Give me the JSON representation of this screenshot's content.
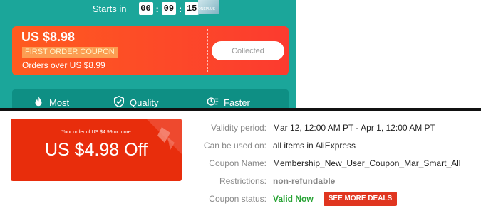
{
  "timer": {
    "label": "Starts in",
    "hours": "00",
    "minutes": "09",
    "seconds": "15",
    "sep": ":"
  },
  "product_tag": "ONEPLUS",
  "coupon": {
    "amount": "US $8.98",
    "badge": "FIRST ORDER COUPON",
    "min_order": "Orders over US $8.99",
    "button": "Collected"
  },
  "features": [
    {
      "label": "Most",
      "icon": "flame-icon"
    },
    {
      "label": "Quality",
      "icon": "shield-check-icon"
    },
    {
      "label": "Faster",
      "icon": "delivery-icon"
    }
  ],
  "offer": {
    "order_text": "Your order of US $4.99 or more",
    "amount": "US $4.98 Off"
  },
  "details": {
    "validity_label": "Validity period:",
    "validity_value": "Mar 12, 12:00 AM PT - Apr 1, 12:00 AM PT",
    "usage_label": "Can be used on:",
    "usage_value": "all items in AliExpress",
    "name_label": "Coupon Name:",
    "name_value": "Membership_New_User_Coupon_Mar_Smart_All",
    "restrictions_label": "Restrictions:",
    "restrictions_value": "non-refundable",
    "status_label": "Coupon status:",
    "status_value": "Valid Now",
    "deals_button": "SEE MORE DEALS"
  },
  "colors": {
    "teal": "#1ba69a",
    "coupon_orange": "#fe5b1f",
    "offer_red": "#e82d0c",
    "valid_green": "#27a334"
  }
}
